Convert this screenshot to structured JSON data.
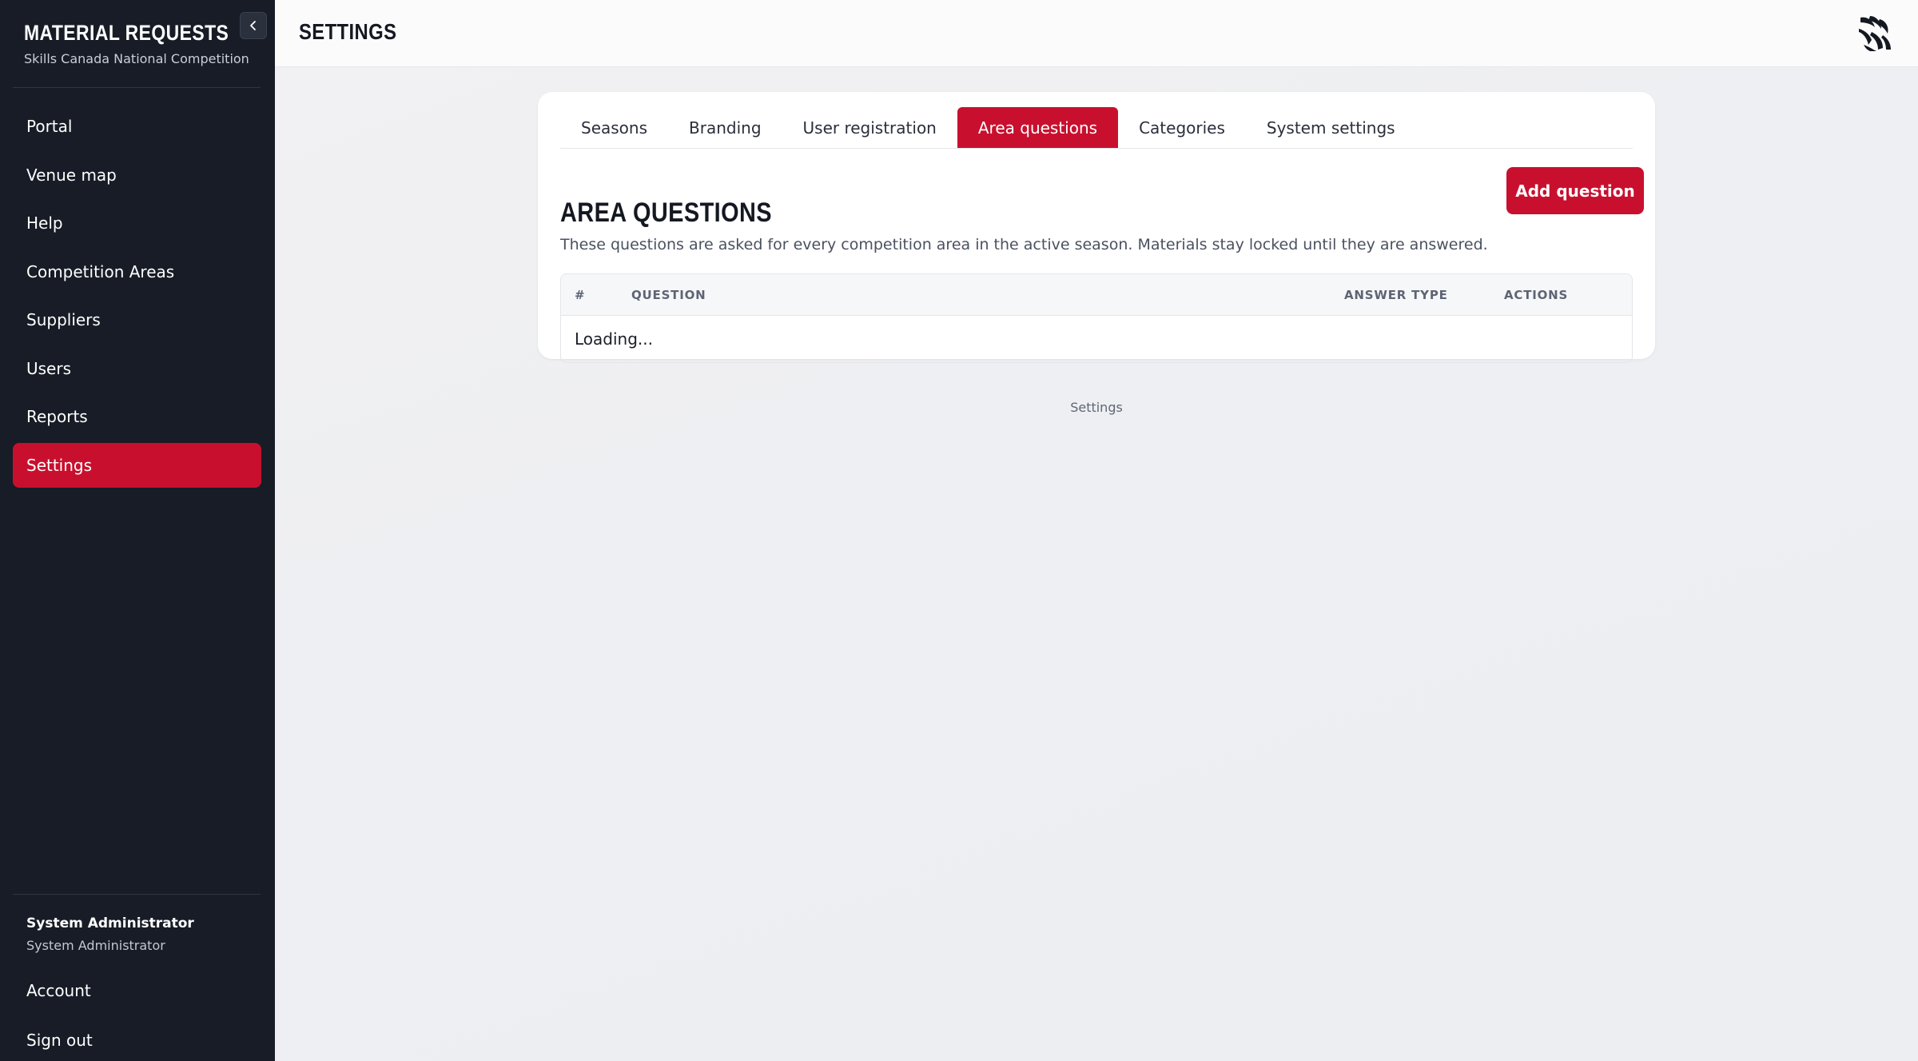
{
  "sidebar": {
    "brand_title": "MATERIAL REQUESTS",
    "brand_subtitle": "Skills Canada National Competition",
    "collapse_icon": "chevron-left-icon",
    "items": [
      {
        "label": "Portal"
      },
      {
        "label": "Venue map"
      },
      {
        "label": "Help"
      },
      {
        "label": "Competition Areas"
      },
      {
        "label": "Suppliers"
      },
      {
        "label": "Users"
      },
      {
        "label": "Reports"
      },
      {
        "label": "Settings",
        "active": true
      }
    ],
    "user": {
      "name": "System Administrator",
      "role": "System Administrator"
    },
    "account_label": "Account",
    "signout_label": "Sign out"
  },
  "header": {
    "title": "SETTINGS",
    "logo_icon": "brand-logo-icon"
  },
  "settings": {
    "tabs": [
      {
        "label": "Seasons"
      },
      {
        "label": "Branding"
      },
      {
        "label": "User registration"
      },
      {
        "label": "Area questions",
        "active": true
      },
      {
        "label": "Categories"
      },
      {
        "label": "System settings"
      }
    ],
    "section_title": "AREA QUESTIONS",
    "section_description": "These questions are asked for every competition area in the active season. Materials stay locked until they are answered.",
    "add_button_label": "Add question",
    "table": {
      "columns": [
        "#",
        "QUESTION",
        "ANSWER TYPE",
        "ACTIONS"
      ],
      "loading_text": "Loading..."
    }
  },
  "footer": {
    "label": "Settings"
  },
  "colors": {
    "accent": "#c8102e",
    "sidebar_bg": "#171c26",
    "page_bg": "#eceef2"
  }
}
